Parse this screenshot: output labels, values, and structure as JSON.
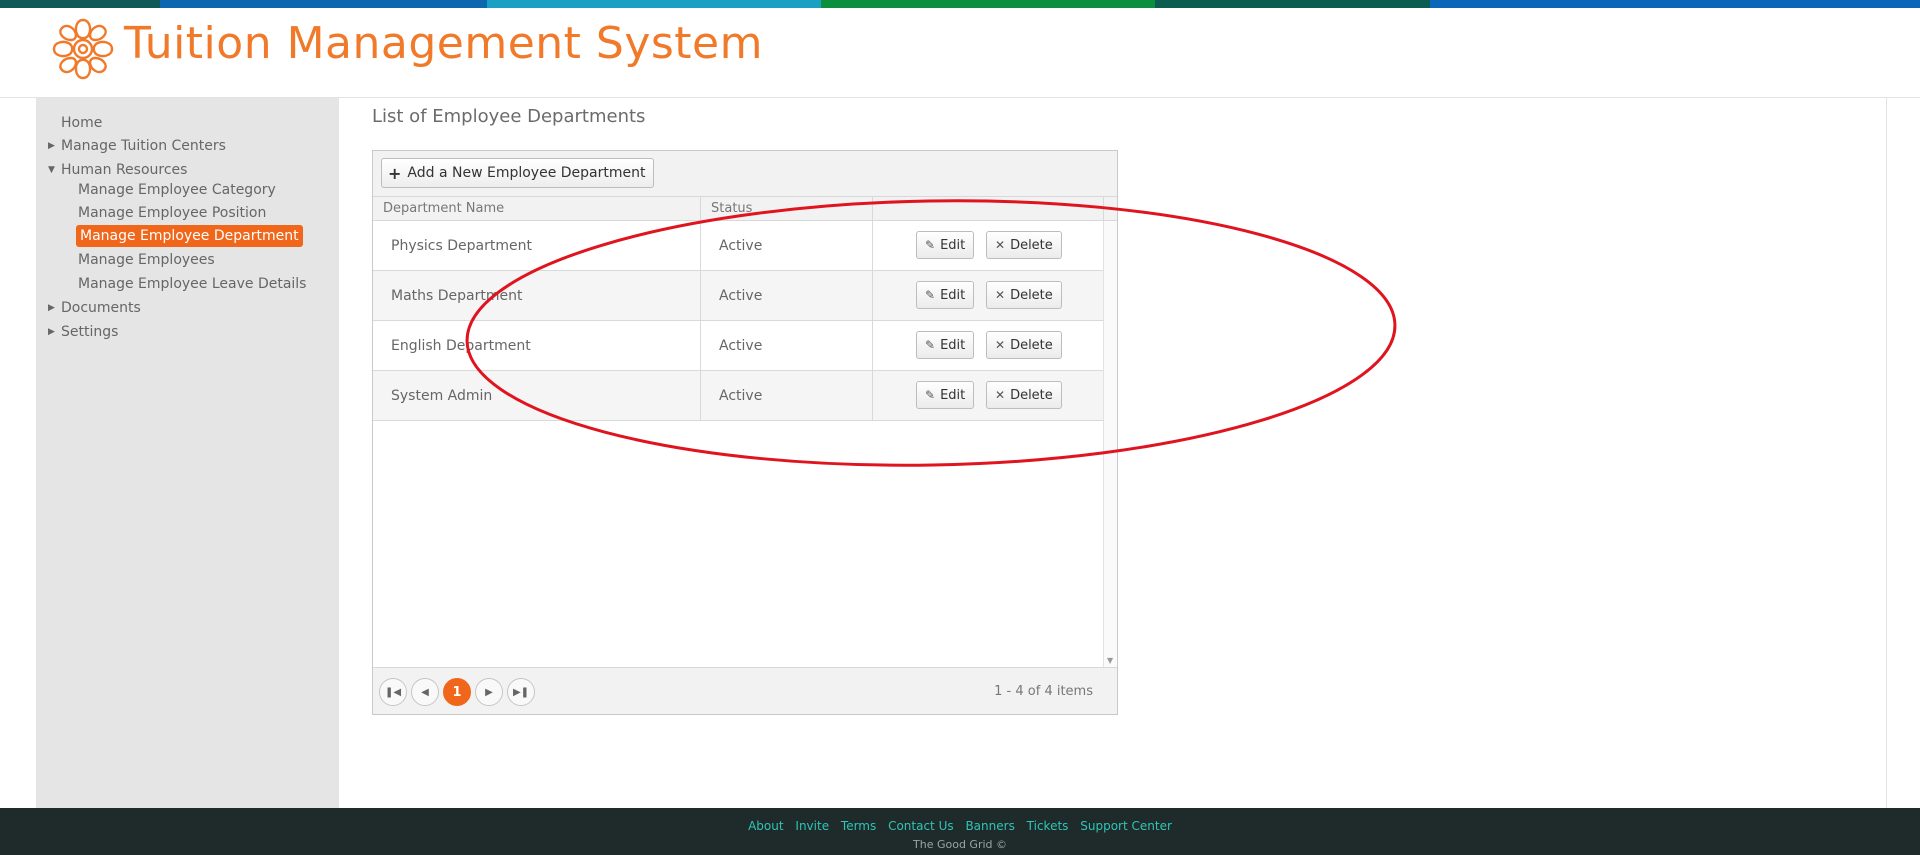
{
  "app": {
    "title": "Tuition Management System"
  },
  "topbar_colors": [
    "#0f5a58",
    "#0c66b0",
    "#1b9fc2",
    "#0a8f3f",
    "#0b5d52",
    "#0a66b8"
  ],
  "sidebar": {
    "items": [
      {
        "label": "Home",
        "caret": ""
      },
      {
        "label": "Manage Tuition Centers",
        "caret": "right"
      },
      {
        "label": "Human Resources",
        "caret": "down"
      },
      {
        "label": "Manage Employee Category",
        "caret": ""
      },
      {
        "label": "Manage Employee Position",
        "caret": ""
      },
      {
        "label": "Manage Employee Department",
        "caret": "",
        "selected": true
      },
      {
        "label": "Manage Employees",
        "caret": ""
      },
      {
        "label": "Manage Employee Leave Details",
        "caret": ""
      },
      {
        "label": "Documents",
        "caret": "right"
      },
      {
        "label": "Settings",
        "caret": "right"
      }
    ]
  },
  "main": {
    "title": "List of Employee Departments",
    "add_button": "Add a New Employee Department",
    "columns": [
      "Department Name",
      "Status"
    ],
    "rows": [
      {
        "name": "Physics Department",
        "status": "Active"
      },
      {
        "name": "Maths Department",
        "status": "Active"
      },
      {
        "name": "English Department",
        "status": "Active"
      },
      {
        "name": "System Admin",
        "status": "Active"
      }
    ],
    "edit_label": "Edit",
    "delete_label": "Delete",
    "pager": {
      "current_page": "1",
      "info": "1 - 4 of 4 items"
    }
  },
  "footer": {
    "links": [
      "About",
      "Invite",
      "Terms",
      "Contact Us",
      "Banners",
      "Tickets",
      "Support Center"
    ],
    "copyright": "The Good Grid ©"
  },
  "colors": {
    "accent": "#f0661a",
    "title": "#f07a2a",
    "annotation": "#e0141e",
    "footer_bg": "#1f2b2b",
    "footer_link": "#2ec4b6"
  }
}
